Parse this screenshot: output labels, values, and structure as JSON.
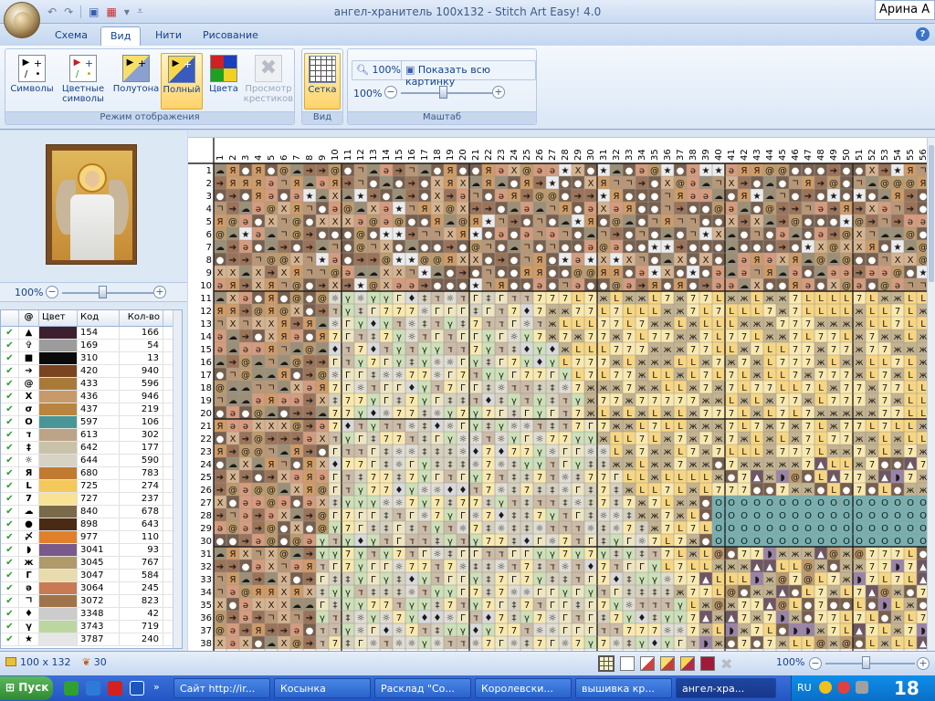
{
  "window": {
    "title": "ангел-хранитель 100x132 - Stitch Art Easy! 4.0",
    "user": "Арина А"
  },
  "tabs": [
    {
      "label": "Схема",
      "active": false
    },
    {
      "label": "Вид",
      "active": true
    },
    {
      "label": "Нити",
      "active": false
    },
    {
      "label": "Рисование",
      "active": false
    }
  ],
  "ribbon": {
    "display_group": {
      "label": "Режим отображения",
      "buttons": [
        {
          "label": "Символы",
          "active": false,
          "disabled": false
        },
        {
          "label": "Цветные символы",
          "active": false,
          "disabled": false
        },
        {
          "label": "Полутона",
          "active": false,
          "disabled": false
        },
        {
          "label": "Полный",
          "active": true,
          "disabled": false
        },
        {
          "label": "Цвета",
          "active": false,
          "disabled": false
        },
        {
          "label": "Просмотр крестиков",
          "active": false,
          "disabled": true
        }
      ]
    },
    "view_group": {
      "label": "Вид",
      "grid_label": "Сетка"
    },
    "scale_group": {
      "label": "Маштаб",
      "zoom_btn": "100%",
      "fit_btn": "Показать всю картинку",
      "zoom_value": "100%"
    }
  },
  "left": {
    "zoom_value": "100%",
    "palette_header": [
      "",
      "@",
      "Цвет",
      "Код",
      "Кол-во"
    ],
    "palette": [
      {
        "sym": "▲",
        "color": "#3d1f2e",
        "code": "154",
        "count": "166"
      },
      {
        "sym": "✞",
        "color": "#9c9c9c",
        "code": "169",
        "count": "54"
      },
      {
        "sym": "■",
        "color": "#0a0a0a",
        "code": "310",
        "count": "13"
      },
      {
        "sym": "➔",
        "color": "#7a4420",
        "code": "420",
        "count": "940"
      },
      {
        "sym": "@",
        "color": "#a87a3a",
        "code": "433",
        "count": "596"
      },
      {
        "sym": "X",
        "color": "#c89a6a",
        "code": "436",
        "count": "946"
      },
      {
        "sym": "σ",
        "color": "#b88440",
        "code": "437",
        "count": "219"
      },
      {
        "sym": "O",
        "color": "#4a9696",
        "code": "597",
        "count": "106"
      },
      {
        "sym": "ד",
        "color": "#bba488",
        "code": "613",
        "count": "302"
      },
      {
        "sym": "‡",
        "color": "#c8c2a8",
        "code": "642",
        "count": "177"
      },
      {
        "sym": "☼",
        "color": "#d6d2c4",
        "code": "644",
        "count": "590"
      },
      {
        "sym": "Я",
        "color": "#c07a32",
        "code": "680",
        "count": "783"
      },
      {
        "sym": "L",
        "color": "#f4c85a",
        "code": "725",
        "count": "274"
      },
      {
        "sym": "7",
        "color": "#f8e294",
        "code": "727",
        "count": "237"
      },
      {
        "sym": "☁",
        "color": "#7a6a4a",
        "code": "840",
        "count": "678"
      },
      {
        "sym": "●",
        "color": "#4a2a12",
        "code": "898",
        "count": "643"
      },
      {
        "sym": "〆",
        "color": "#e0802a",
        "code": "977",
        "count": "110"
      },
      {
        "sym": "◗",
        "color": "#7a5a8a",
        "code": "3041",
        "count": "93"
      },
      {
        "sym": "ж",
        "color": "#b09a6a",
        "code": "3045",
        "count": "767"
      },
      {
        "sym": "Г",
        "color": "#e8dcae",
        "code": "3047",
        "count": "584"
      },
      {
        "sym": "ə",
        "color": "#c87a52",
        "code": "3064",
        "count": "245"
      },
      {
        "sym": "ㄱ",
        "color": "#a0744a",
        "code": "3072",
        "count": "823"
      },
      {
        "sym": "♦",
        "color": "#cccccc",
        "code": "3348",
        "count": "42"
      },
      {
        "sym": "γ",
        "color": "#bcd6a0",
        "code": "3743",
        "count": "719"
      },
      {
        "sym": "★",
        "color": "#e6e6e6",
        "code": "3787",
        "count": "240"
      }
    ]
  },
  "grid": {
    "first_col": 1,
    "last_col": 56,
    "first_row": 1,
    "last_row": 38
  },
  "status": {
    "size": "100 x 132",
    "colors": "30",
    "zoom": "100%"
  },
  "taskbar": {
    "start": "Пуск",
    "buttons": [
      {
        "label": "Сайт http://ir...",
        "active": false
      },
      {
        "label": "Косынка",
        "active": false
      },
      {
        "label": "Расклад \"Со...",
        "active": false
      },
      {
        "label": "Королевски...",
        "active": false
      },
      {
        "label": "вышивка кр...",
        "active": false
      },
      {
        "label": "ангел-хра...",
        "active": true
      }
    ],
    "tray_lang": "RU",
    "tray_time": "18"
  }
}
